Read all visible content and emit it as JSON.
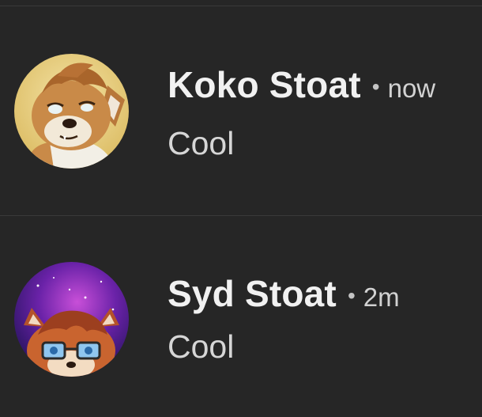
{
  "conversations": [
    {
      "sender": "Koko Stoat",
      "separator": "•",
      "timestamp": "now",
      "message": "Cool",
      "avatar_icon": "wolf-character-avatar"
    },
    {
      "sender": "Syd Stoat",
      "separator": "•",
      "timestamp": "2m",
      "message": "Cool",
      "avatar_icon": "fox-character-with-glasses-avatar"
    }
  ],
  "colors": {
    "background": "#262626",
    "divider": "#3a3a3a",
    "name": "#f1f1f1",
    "message": "#d6d6d6"
  }
}
